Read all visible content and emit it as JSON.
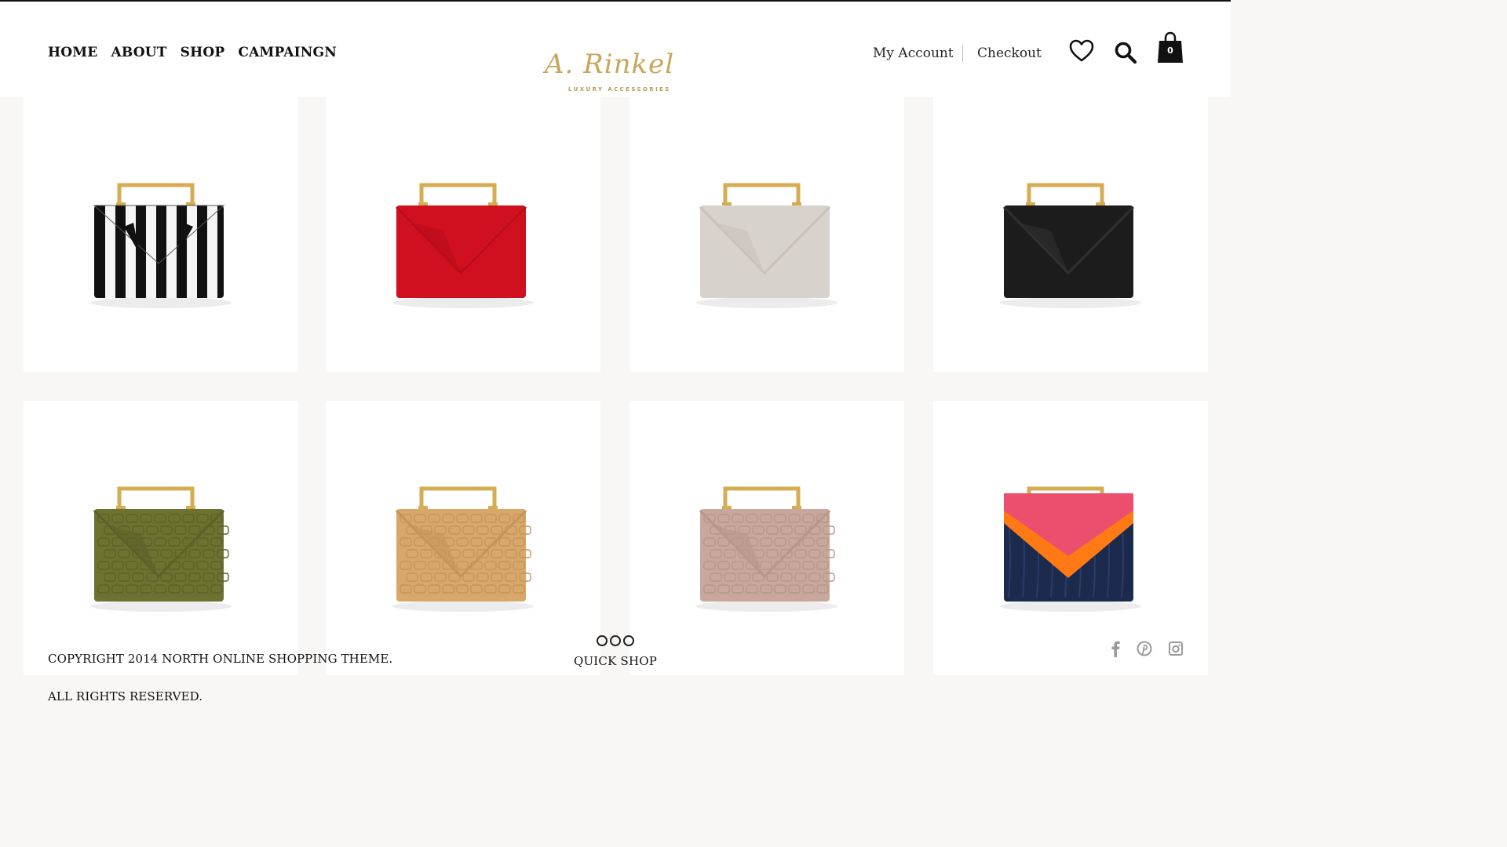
{
  "nav": {
    "items": [
      "HOME",
      "ABOUT",
      "SHOP",
      "CAMPAINGN"
    ]
  },
  "logo": {
    "script": "A. Rinkel",
    "tagline": "LUXURY ACCESSORIES"
  },
  "account": {
    "my_account": "My Account",
    "checkout": "Checkout",
    "cart_count": "0"
  },
  "icons": {
    "wishlist": "heart-icon",
    "search": "search-icon",
    "cart": "shopping-bag-icon"
  },
  "products": [
    {
      "name": "striped clutch",
      "colors": {
        "body": "#111111",
        "accent": "#f5f5f5",
        "pattern": "stripes"
      }
    },
    {
      "name": "red clutch",
      "colors": {
        "body": "#d0101f",
        "accent": "#b80d1a",
        "pattern": "plain"
      }
    },
    {
      "name": "taupe clutch",
      "colors": {
        "body": "#d8d2cc",
        "accent": "#c9c2bb",
        "pattern": "plain"
      }
    },
    {
      "name": "black clutch",
      "colors": {
        "body": "#1c1c1c",
        "accent": "#303030",
        "pattern": "plain"
      }
    },
    {
      "name": "olive croc clutch",
      "colors": {
        "body": "#6e7231",
        "accent": "#5d6128",
        "pattern": "croc"
      }
    },
    {
      "name": "camel croc clutch",
      "colors": {
        "body": "#d8a86a",
        "accent": "#c4955a",
        "pattern": "croc"
      }
    },
    {
      "name": "rose croc clutch",
      "colors": {
        "body": "#c8a79d",
        "accent": "#b8968c",
        "pattern": "croc"
      }
    },
    {
      "name": "tricolor croc clutch",
      "colors": {
        "body": "#1c2a4e",
        "accent": "#ff7a14",
        "flap": "#ec4e6e",
        "pattern": "tricolor"
      }
    }
  ],
  "footer": {
    "copyright": "COPYRIGHT 2014 NORTH ONLINE SHOPPING THEME. ALL RIGHTS RESERVED.",
    "quick_shop": "QUICK SHOP",
    "social": [
      "facebook-icon",
      "pinterest-icon",
      "instagram-icon"
    ]
  },
  "theme": {
    "gold": "#d6ac52",
    "background": "#f8f7f5"
  }
}
